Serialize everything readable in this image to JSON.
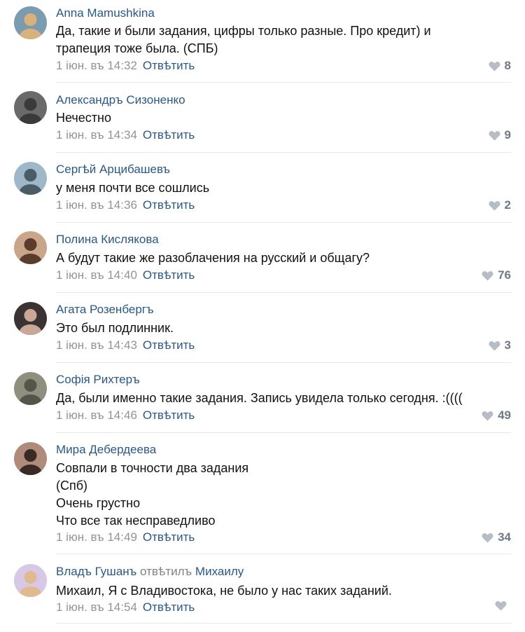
{
  "colors": {
    "link": "#2a5885",
    "muted": "#939393",
    "like": "#b7bdc4",
    "divider": "#e3e6ea"
  },
  "comments": [
    {
      "author": "Anna Mamushkina",
      "lines": [
        "Да, такие и были задания, цифры только разные. Про кредит) и",
        "трапеция тоже была. (СПБ)"
      ],
      "date": "1 іюн. въ 14:32",
      "reply_label": "Отвѣтить",
      "likes": "8",
      "avatar_icon": "user-avatar"
    },
    {
      "author": "Александръ Сизоненко",
      "lines": [
        "Нечестно"
      ],
      "date": "1 іюн. въ 14:34",
      "reply_label": "Отвѣтить",
      "likes": "9",
      "avatar_icon": "user-avatar"
    },
    {
      "author": "Сергѣй Арцибашевъ",
      "lines": [
        "у меня почти все сошлись"
      ],
      "date": "1 іюн. въ 14:36",
      "reply_label": "Отвѣтить",
      "likes": "2",
      "avatar_icon": "user-avatar"
    },
    {
      "author": "Полина Кислякова",
      "lines": [
        "А будут такие же разоблачения на русский и общагу?"
      ],
      "date": "1 іюн. въ 14:40",
      "reply_label": "Отвѣтить",
      "likes": "76",
      "avatar_icon": "user-avatar"
    },
    {
      "author": "Агата Розенбергъ",
      "lines": [
        "Это был подлинник."
      ],
      "date": "1 іюн. въ 14:43",
      "reply_label": "Отвѣтить",
      "likes": "3",
      "avatar_icon": "user-avatar"
    },
    {
      "author": "Софія Рихтеръ",
      "lines": [
        "Да, были именно такие задания. Запись увидела только сегодня. :(((("
      ],
      "date": "1 іюн. въ 14:46",
      "reply_label": "Отвѣтить",
      "likes": "49",
      "avatar_icon": "user-avatar"
    },
    {
      "author": "Мира Дебердеева",
      "lines": [
        "Совпали в точности два задания",
        "(Спб)",
        "Очень грустно",
        "Что все так несправедливо"
      ],
      "date": "1 іюн. въ 14:49",
      "reply_label": "Отвѣтить",
      "likes": "34",
      "avatar_icon": "user-avatar"
    },
    {
      "author": "Владъ Гушанъ",
      "reply_note": "отвѣтилъ",
      "reply_to": "Михаилу",
      "lines": [
        "Михаил, Я с Владивостока, не было у нас таких заданий."
      ],
      "date": "1 іюн. въ 14:54",
      "reply_label": "Отвѣтить",
      "likes": "",
      "avatar_icon": "user-avatar"
    }
  ]
}
